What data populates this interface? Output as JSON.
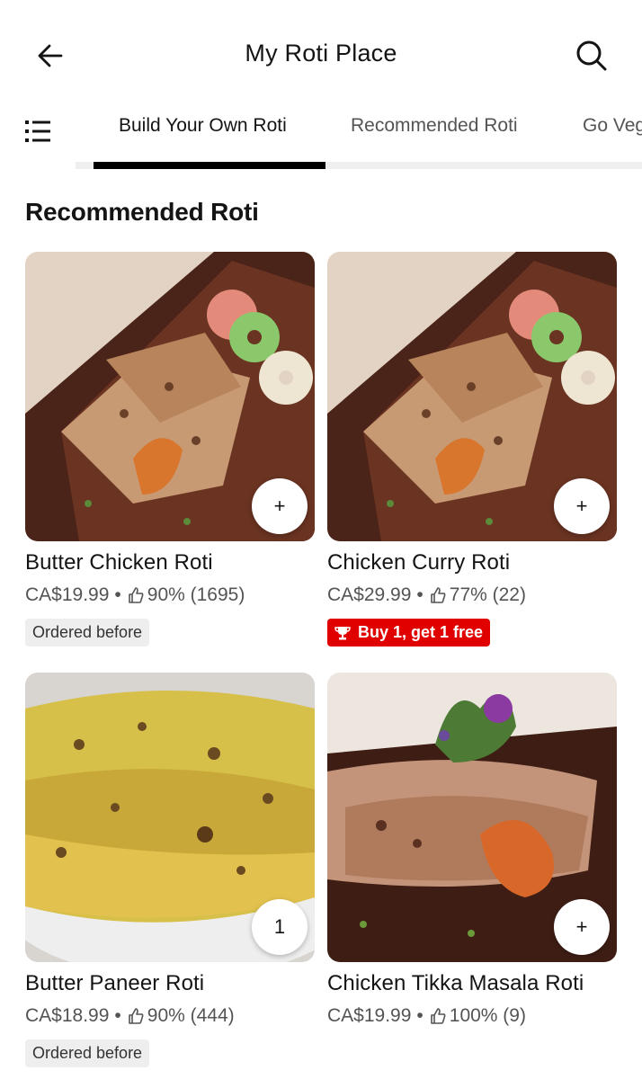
{
  "header": {
    "title": "My Roti Place",
    "back_icon": "arrow-left-icon",
    "search_icon": "search-icon"
  },
  "tabs": {
    "menu_icon": "list-menu-icon",
    "items": [
      {
        "label": "Build Your Own Roti",
        "active": true
      },
      {
        "label": "Recommended Roti",
        "active": false
      },
      {
        "label": "Go Veg",
        "active": false
      }
    ]
  },
  "section": {
    "title": "Recommended Roti"
  },
  "items": [
    {
      "name": "Butter Chicken Roti",
      "price": "CA$19.99",
      "rating": "90% (1695)",
      "badge": "Ordered before",
      "cart": "+"
    },
    {
      "name": "Chicken Curry Roti",
      "price": "CA$29.99",
      "rating": "77% (22)",
      "badge": "Buy 1, get 1 free",
      "cart": "+"
    },
    {
      "name": "Butter Paneer Roti",
      "price": "CA$18.99",
      "rating": "90% (444)",
      "badge": "Ordered before",
      "cart": "1"
    },
    {
      "name": "Chicken Tikka Masala Roti",
      "price": "CA$19.99",
      "rating": "100% (9)",
      "badge": "",
      "cart": "+"
    }
  ],
  "colors": {
    "active_tab_indicator": "#000000",
    "promo_badge": "#e00000",
    "grey_badge": "#eeeeee",
    "secondary_text": "#545454"
  },
  "separator": "•"
}
